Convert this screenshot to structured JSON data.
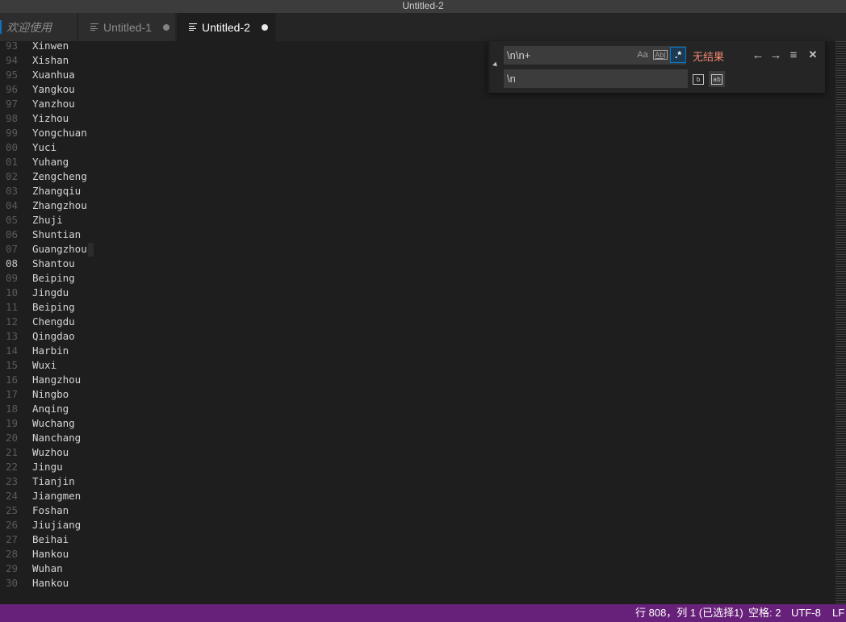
{
  "window": {
    "title": "Untitled-2"
  },
  "tabs": [
    {
      "label": "欢迎使用"
    },
    {
      "label": "Untitled-1"
    },
    {
      "label": "Untitled-2"
    }
  ],
  "editor": {
    "line_numbers": [
      "93",
      "94",
      "95",
      "96",
      "97",
      "98",
      "99",
      "00",
      "01",
      "02",
      "03",
      "04",
      "05",
      "06",
      "07",
      "08",
      "09",
      "10",
      "11",
      "12",
      "13",
      "14",
      "15",
      "16",
      "17",
      "18",
      "19",
      "20",
      "21",
      "22",
      "23",
      "24",
      "25",
      "26",
      "27",
      "28",
      "29",
      "30"
    ],
    "lines": [
      "Xinwen",
      "Xishan",
      "Xuanhua",
      "Yangkou",
      "Yanzhou",
      "Yizhou",
      "Yongchuan",
      "Yuci",
      "Yuhang",
      "Zengcheng",
      "Zhangqiu",
      "Zhangzhou",
      "Zhuji",
      "Shuntian",
      "Guangzhou",
      "Shantou",
      "Beiping",
      "Jingdu",
      "Beiping",
      "Chengdu",
      "Qingdao",
      "Harbin",
      "Wuxi",
      "Hangzhou",
      "Ningbo",
      "Anqing",
      "Wuchang",
      "Nanchang",
      "Wuzhou",
      "Jingu",
      "Tianjin",
      "Jiangmen",
      "Foshan",
      "Jiujiang",
      "Beihai",
      "Hankou",
      "Wuhan",
      "Hankou"
    ],
    "current_line_index": 15,
    "cursor_line_index": 14
  },
  "find_widget": {
    "find_value": "\\n\\n+",
    "replace_value": "\\n",
    "match_case_label": "Aa",
    "whole_word_label": "Ab|",
    "regex_label": ".*",
    "no_results": "无结果",
    "prev_glyph": "←",
    "next_glyph": "→",
    "selection_glyph": "≡",
    "close_glyph": "✕",
    "replace_one_label": "b",
    "replace_all_label": "ab"
  },
  "statusbar": {
    "position": "行 808，列 1 (已选择1)",
    "indent": "空格: 2",
    "encoding": "UTF-8",
    "eol": "LF"
  },
  "colors": {
    "statusbar_bg": "#68217a",
    "accent": "#007acc",
    "no_results": "#f48771",
    "editor_bg": "#1e1e1e"
  }
}
